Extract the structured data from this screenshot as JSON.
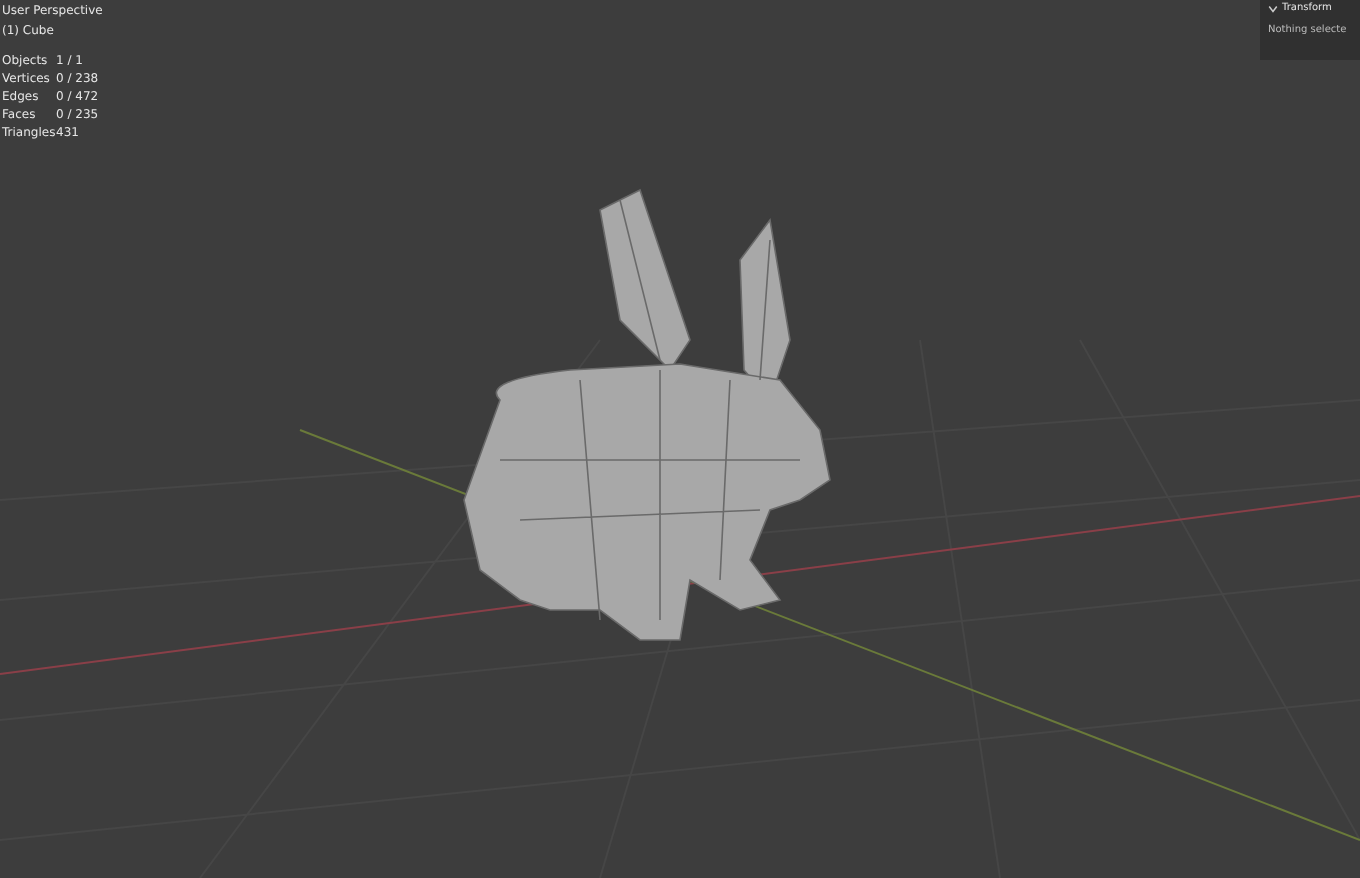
{
  "viewport": {
    "view_name": "User Perspective",
    "object_name": "(1) Cube"
  },
  "statistics": [
    {
      "label": "Objects",
      "value": "1 / 1"
    },
    {
      "label": "Vertices",
      "value": "0 / 238"
    },
    {
      "label": "Edges",
      "value": "0 / 472"
    },
    {
      "label": "Faces",
      "value": "0 / 235"
    },
    {
      "label": "Triangles",
      "value": "431"
    }
  ],
  "sidebar": {
    "panel_title": "Transform",
    "expanded": true,
    "message": "Nothing selecte"
  }
}
